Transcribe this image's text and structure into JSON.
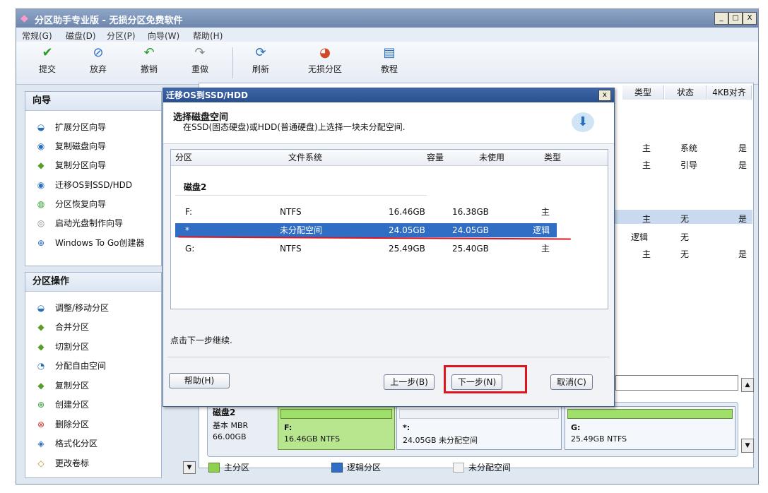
{
  "app": {
    "title": "分区助手专业版 - 无损分区免费软件"
  },
  "window_buttons": [
    "_",
    "□",
    "X"
  ],
  "menu": [
    "常规(G)",
    "磁盘(D)",
    "分区(P)",
    "向导(W)",
    "帮助(H)"
  ],
  "toolbar": [
    "提交",
    "放弃",
    "撤销",
    "重做",
    "刷新",
    "无损分区",
    "教程"
  ],
  "wizard_panel": {
    "title": "向导",
    "items": [
      "扩展分区向导",
      "复制磁盘向导",
      "复制分区向导",
      "迁移OS到SSD/HDD",
      "分区恢复向导",
      "启动光盘制作向导",
      "Windows To Go创建器"
    ]
  },
  "ops_panel": {
    "title": "分区操作",
    "items": [
      "调整/移动分区",
      "合并分区",
      "切割分区",
      "分配自由空间",
      "复制分区",
      "创建分区",
      "删除分区",
      "格式化分区",
      "更改卷标"
    ]
  },
  "right_table": {
    "headers": [
      "类型",
      "状态",
      "4KB对齐"
    ],
    "rows": [
      [
        "主",
        "系统",
        "是"
      ],
      [
        "主",
        "引导",
        "是"
      ],
      [
        "主",
        "无",
        "是"
      ],
      [
        "逻辑",
        "无",
        ""
      ],
      [
        "主",
        "无",
        "是"
      ]
    ]
  },
  "dialog": {
    "title": "迁移OS到SSD/HDD",
    "close": "x",
    "heading": "选择磁盘空间",
    "subheading": "在SSD(固态硬盘)或HDD(普通硬盘)上选择一块未分配空间.",
    "columns": [
      "分区",
      "文件系统",
      "容量",
      "未使用",
      "类型"
    ],
    "disk_label": "磁盘2",
    "rows": [
      {
        "part": "F:",
        "fs": "NTFS",
        "cap": "16.46GB",
        "free": "16.38GB",
        "type": "主"
      },
      {
        "part": "*",
        "fs": "未分配空间",
        "cap": "24.05GB",
        "free": "24.05GB",
        "type": "逻辑"
      },
      {
        "part": "G:",
        "fs": "NTFS",
        "cap": "25.49GB",
        "free": "25.40GB",
        "type": "主"
      }
    ],
    "hint": "点击下一步继续.",
    "buttons": {
      "help": "帮助(H)",
      "prev": "上一步(B)",
      "next": "下一步(N)",
      "cancel": "取消(C)"
    }
  },
  "disk_map": {
    "disk": {
      "name": "磁盘2",
      "kind": "基本 MBR",
      "size": "66.00GB"
    },
    "parts": [
      {
        "label": "F:",
        "detail": "16.46GB NTFS"
      },
      {
        "label": "*:",
        "detail": "24.05GB 未分配空间"
      },
      {
        "label": "G:",
        "detail": "25.49GB NTFS"
      }
    ]
  },
  "legend": [
    "主分区",
    "逻辑分区",
    "未分配空间"
  ],
  "colors": {
    "selection": "#2f6ec4",
    "highlight_box": "#e0141e",
    "primary": "#8fd14f",
    "logical": "#2f6ec4"
  }
}
